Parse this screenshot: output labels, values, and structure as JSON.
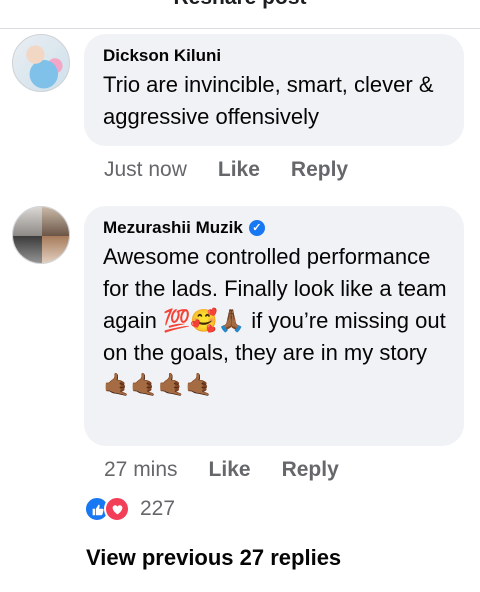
{
  "header": {
    "title": "Reshare post"
  },
  "comments": [
    {
      "author": "Dickson Kiluni",
      "text": "Trio are invincible, smart, clever & aggressive offensively",
      "time": "Just now",
      "like_label": "Like",
      "reply_label": "Reply"
    },
    {
      "author": "Mezurashii Muzik",
      "verified": true,
      "text_line1": "Awesome controlled performance for the lads. Finally look like a team again",
      "text_emoji": "💯🥰🙏🏾",
      "text_line2": "if you’re missing out on the goals, they are in my story",
      "emoji_line": "🤙🏾🤙🏾🤙🏾🤙🏾",
      "time": "27 mins",
      "like_label": "Like",
      "reply_label": "Reply",
      "reaction_count": "227"
    }
  ],
  "view_previous": "View previous 27 replies",
  "icons": {
    "like": "thumbs-up-icon",
    "love": "heart-icon",
    "verified": "verified-badge-icon"
  },
  "colors": {
    "like": "#1877f2",
    "love": "#f33e58",
    "bubble": "#f0f2f5"
  }
}
